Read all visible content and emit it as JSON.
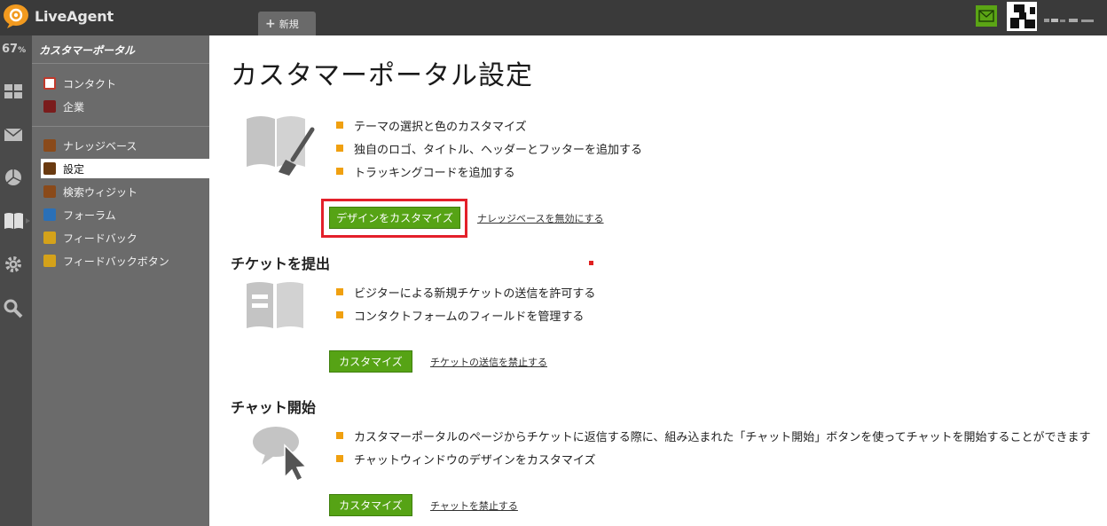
{
  "app": {
    "name": "LiveAgent",
    "new_tab_label": "新規",
    "load": "67",
    "load_unit": "%"
  },
  "sidebar": {
    "title": "カスタマーポータル",
    "items": [
      {
        "label": "コンタクト",
        "icon": "contact-icon",
        "color": "#c0392b"
      },
      {
        "label": "企業",
        "icon": "company-icon",
        "color": "#7a1c1c"
      },
      {
        "label": "ナレッジベース",
        "icon": "knowledgebase-icon",
        "color": "#8a4a1a"
      },
      {
        "label": "設定",
        "icon": "settings-icon",
        "color": "#6a3a10",
        "active": true
      },
      {
        "label": "検索ウィジット",
        "icon": "search-widget-icon",
        "color": "#8a4a1a"
      },
      {
        "label": "フォーラム",
        "icon": "forum-icon",
        "color": "#2a70b8"
      },
      {
        "label": "フィードバック",
        "icon": "feedback-icon",
        "color": "#d4a21a"
      },
      {
        "label": "フィードバックボタン",
        "icon": "feedback-button-icon",
        "color": "#d4a21a"
      }
    ]
  },
  "main": {
    "title": "カスタマーポータル設定",
    "design": {
      "bullets": [
        "テーマの選択と色のカスタマイズ",
        "独自のロゴ、タイトル、ヘッダーとフッターを追加する",
        "トラッキングコードを追加する"
      ],
      "button": "デザインをカスタマイズ",
      "link": "ナレッジベースを無効にする"
    },
    "ticket": {
      "title": "チケットを提出",
      "bullets": [
        "ビジターによる新規チケットの送信を許可する",
        "コンタクトフォームのフィールドを管理する"
      ],
      "button": "カスタマイズ",
      "link": "チケットの送信を禁止する"
    },
    "chat": {
      "title": "チャット開始",
      "bullets": [
        "カスタマーポータルのページからチケットに返信する際に、組み込まれた「チャット開始」ボタンを使ってチャットを開始することができます",
        "チャットウィンドウのデザインをカスタマイズ"
      ],
      "button": "カスタマイズ",
      "link": "チャットを禁止する"
    }
  },
  "colors": {
    "accent_green": "#56a315",
    "bullet_orange": "#f0a010",
    "highlight_red": "#e3202a",
    "topbar": "#3a3a3a",
    "sidebar": "#6b6b6b"
  }
}
